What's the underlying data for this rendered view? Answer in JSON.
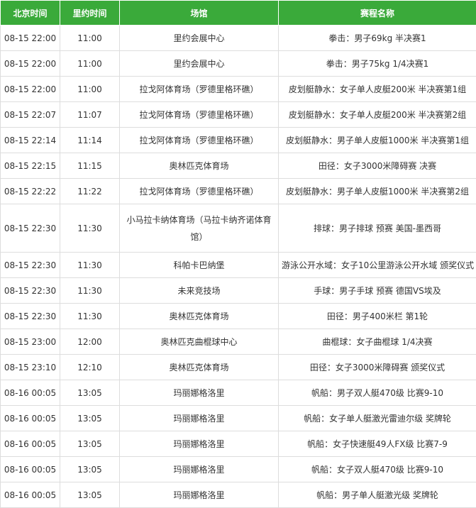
{
  "headers": {
    "beijing_time": "北京时间",
    "rio_time": "里约时间",
    "venue": "场馆",
    "event": "赛程名称"
  },
  "colors": {
    "header_bg": "#3aaa3a",
    "header_text": "#ffffff",
    "border": "#dddddd"
  },
  "rows": [
    {
      "beijing": "08-15 22:00",
      "rio": "11:00",
      "venue": "里约会展中心",
      "event": "拳击：男子69kg 半决赛1"
    },
    {
      "beijing": "08-15 22:00",
      "rio": "11:00",
      "venue": "里约会展中心",
      "event": "拳击：男子75kg 1/4决赛1"
    },
    {
      "beijing": "08-15 22:00",
      "rio": "11:00",
      "venue": "拉戈阿体育场（罗德里格环礁）",
      "event": "皮划艇静水：女子单人皮艇200米 半决赛第1组"
    },
    {
      "beijing": "08-15 22:07",
      "rio": "11:07",
      "venue": "拉戈阿体育场（罗德里格环礁）",
      "event": "皮划艇静水：女子单人皮艇200米 半决赛第2组"
    },
    {
      "beijing": "08-15 22:14",
      "rio": "11:14",
      "venue": "拉戈阿体育场（罗德里格环礁）",
      "event": "皮划艇静水：男子单人皮艇1000米 半决赛第1组"
    },
    {
      "beijing": "08-15 22:15",
      "rio": "11:15",
      "venue": "奥林匹克体育场",
      "event": "田径：女子3000米障碍赛 决赛"
    },
    {
      "beijing": "08-15 22:22",
      "rio": "11:22",
      "venue": "拉戈阿体育场（罗德里格环礁）",
      "event": "皮划艇静水：男子单人皮艇1000米 半决赛第2组"
    },
    {
      "beijing": "08-15 22:30",
      "rio": "11:30",
      "venue": "小马拉卡纳体育场（马拉卡纳齐诺体育馆）",
      "event": "排球：男子排球 预赛 美国-墨西哥",
      "tall": true
    },
    {
      "beijing": "08-15 22:30",
      "rio": "11:30",
      "venue": "科帕卡巴纳堡",
      "event": "游泳公开水域：女子10公里游泳公开水域 颁奖仪式"
    },
    {
      "beijing": "08-15 22:30",
      "rio": "11:30",
      "venue": "未来竞技场",
      "event": "手球：男子手球 预赛 德国VS埃及"
    },
    {
      "beijing": "08-15 22:30",
      "rio": "11:30",
      "venue": "奥林匹克体育场",
      "event": "田径：男子400米栏 第1轮"
    },
    {
      "beijing": "08-15 23:00",
      "rio": "12:00",
      "venue": "奥林匹克曲棍球中心",
      "event": "曲棍球：女子曲棍球 1/4决赛"
    },
    {
      "beijing": "08-15 23:10",
      "rio": "12:10",
      "venue": "奥林匹克体育场",
      "event": "田径：女子3000米障碍赛 颁奖仪式"
    },
    {
      "beijing": "08-16 00:05",
      "rio": "13:05",
      "venue": "玛丽娜格洛里",
      "event": "帆船：男子双人艇470级 比赛9-10"
    },
    {
      "beijing": "08-16 00:05",
      "rio": "13:05",
      "venue": "玛丽娜格洛里",
      "event": "帆船：女子单人艇激光雷迪尔级 奖牌轮"
    },
    {
      "beijing": "08-16 00:05",
      "rio": "13:05",
      "venue": "玛丽娜格洛里",
      "event": "帆船：女子快速艇49人FX级 比赛7-9"
    },
    {
      "beijing": "08-16 00:05",
      "rio": "13:05",
      "venue": "玛丽娜格洛里",
      "event": "帆船：女子双人艇470级 比赛9-10"
    },
    {
      "beijing": "08-16 00:05",
      "rio": "13:05",
      "venue": "玛丽娜格洛里",
      "event": "帆船：男子单人艇激光级 奖牌轮"
    }
  ]
}
